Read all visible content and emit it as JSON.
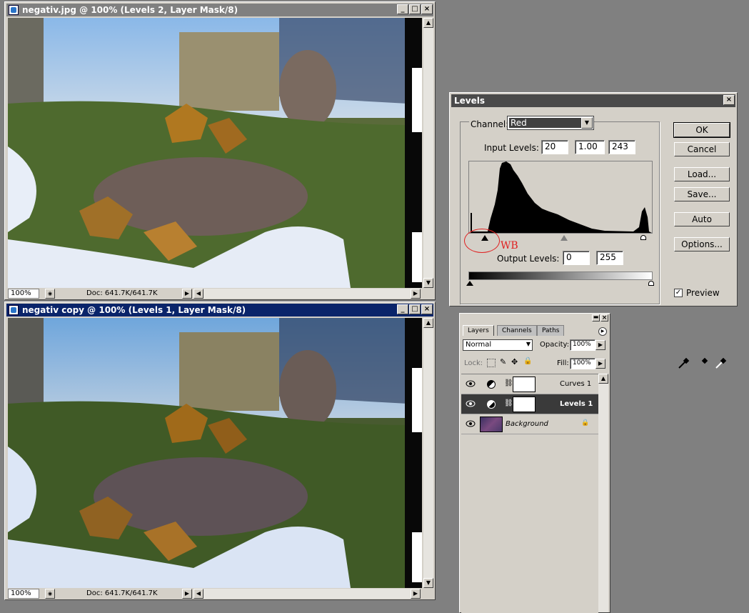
{
  "doc1": {
    "title": "negativ.jpg @ 100% (Levels 2, Layer Mask/8)",
    "zoom": "100%",
    "doc_info": "Doc: 641.7K/641.7K"
  },
  "doc2": {
    "title": "negativ copy @ 100% (Levels 1, Layer Mask/8)",
    "zoom": "100%",
    "doc_info": "Doc: 641.7K/641.7K"
  },
  "window_buttons": {
    "minimize": "_",
    "maximize": "□",
    "close": "×"
  },
  "levels": {
    "title": "Levels",
    "channel_label": "Channel:",
    "channel_value": "Red",
    "input_levels_label": "Input Levels:",
    "input_black": "20",
    "input_gamma": "1.00",
    "input_white": "243",
    "output_levels_label": "Output Levels:",
    "output_black": "0",
    "output_white": "255",
    "annotation": "WB",
    "buttons": {
      "ok": "OK",
      "cancel": "Cancel",
      "load": "Load...",
      "save": "Save...",
      "auto": "Auto",
      "options": "Options..."
    },
    "preview_label": "Preview",
    "preview_checked": true,
    "annotation_color": "#e02020"
  },
  "layers": {
    "tabs": [
      "Layers",
      "Channels",
      "Paths"
    ],
    "blend_mode": "Normal",
    "opacity_label": "Opacity:",
    "opacity": "100%",
    "lock_label": "Lock:",
    "fill_label": "Fill:",
    "fill": "100%",
    "items": [
      {
        "name": "Curves 1",
        "selected": false
      },
      {
        "name": "Levels 1",
        "selected": true
      },
      {
        "name": "Background",
        "selected": false
      }
    ]
  }
}
